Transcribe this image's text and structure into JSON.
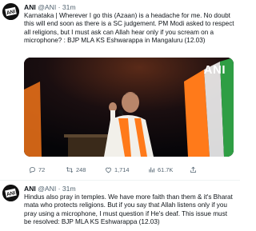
{
  "tweets": [
    {
      "author_name": "ANI",
      "handle_time": "@ANI · 31m",
      "text": "Karnataka | Wherever I go this (Azaan) is a headache for me. No doubt this will end soon as there is a SC judgement. PM Modi asked to respect all religions, but I must ask can Allah hear only if you scream on a microphone? : BJP MLA KS Eshwarappa in Mangaluru (12.03)",
      "media_watermark": "ANI",
      "actions": {
        "replies": "72",
        "retweets": "248",
        "likes": "1,714",
        "views": "61.7K"
      }
    },
    {
      "author_name": "ANI",
      "handle_time": "@ANI · 31m",
      "text": "Hindus also pray in temples. We have more faith than them & it's Bharat mata who protects religions. But if you say that Allah listens only if you pray using a microphone, I must question if He's deaf. This issue must be resolved: BJP MLA KS Eshwarappa (12.03)"
    }
  ],
  "icons": {
    "avatar": "ani-logo-icon",
    "reply": "reply-icon",
    "retweet": "retweet-icon",
    "like": "heart-icon",
    "views": "bar-chart-icon",
    "share": "share-icon"
  },
  "colors": {
    "text": "#0f1419",
    "secondary_text": "#536471",
    "saffron": "#ff7a1a",
    "green": "#2f9e44"
  }
}
